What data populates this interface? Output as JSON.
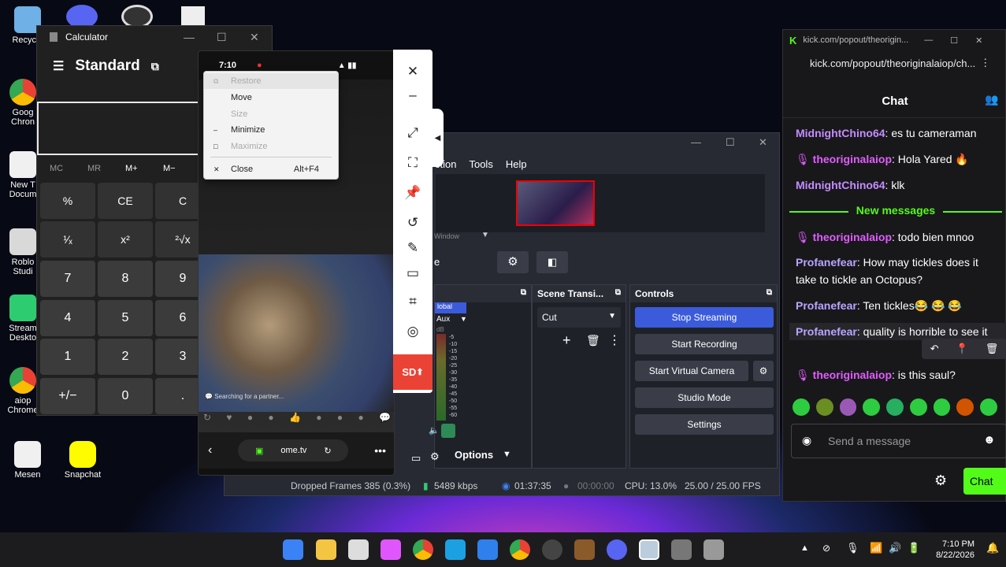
{
  "desktop": {
    "icons": [
      {
        "label": "Recycle",
        "color": "#6fb0e6"
      },
      {
        "label": "Goog\nChron",
        "color": "#e94235"
      },
      {
        "label": "New T\nDocum",
        "color": "#f0f0f0"
      },
      {
        "label": "Roblo\nStudi",
        "color": "#d9d9d9"
      },
      {
        "label": "Stream\nDeskto",
        "color": "#2ecc71"
      },
      {
        "label": "aiop\nChrome",
        "color": "#e94235"
      },
      {
        "label": "Mesen",
        "color": "#f0f0f0"
      },
      {
        "label": "Snapchat",
        "color": "#fffc00"
      }
    ]
  },
  "calculator": {
    "title": "Calculator",
    "mode": "Standard",
    "memory": [
      "MC",
      "MR",
      "M+",
      "M−"
    ],
    "keys": [
      "%",
      "CE",
      "C",
      "¹⁄ₓ",
      "x²",
      "²√x",
      "7",
      "8",
      "9",
      "4",
      "5",
      "6",
      "1",
      "2",
      "3",
      "+/−",
      "0",
      "."
    ]
  },
  "phone": {
    "time": "7:10",
    "searching": "Searching for a partner...",
    "url": "ome.tv"
  },
  "context_menu": {
    "items": [
      {
        "label": "Restore",
        "glyph": "⧉",
        "accel": "",
        "disabled": true
      },
      {
        "label": "Move",
        "glyph": "",
        "accel": "",
        "disabled": false
      },
      {
        "label": "Size",
        "glyph": "",
        "accel": "",
        "disabled": true
      },
      {
        "label": "Minimize",
        "glyph": "–",
        "accel": "",
        "disabled": false
      },
      {
        "label": "Maximize",
        "glyph": "□",
        "accel": "",
        "disabled": true
      },
      {
        "label": "Close",
        "glyph": "✕",
        "accel": "Alt+F4",
        "disabled": false
      }
    ]
  },
  "snip_toolbar": {
    "sd_label": "SD"
  },
  "obs": {
    "menu": [
      "ction",
      "Tools",
      "Help"
    ],
    "source_label": "Window",
    "scene_label": "e",
    "mixer": {
      "header": "",
      "global": "lobal",
      "aux": "Aux",
      "db": "dB",
      "levels": [
        "-5",
        "-10",
        "-15",
        "-20",
        "-25",
        "-30",
        "-35",
        "-40",
        "-45",
        "-50",
        "-55",
        "-60"
      ]
    },
    "transitions": {
      "header": "Scene Transi...",
      "value": "Cut"
    },
    "controls": {
      "header": "Controls",
      "stop_streaming": "Stop Streaming",
      "start_recording": "Start Recording",
      "start_virtual_camera": "Start Virtual Camera",
      "studio_mode": "Studio Mode",
      "settings": "Settings"
    },
    "options_label": "Options",
    "status": {
      "dropped": "Dropped Frames 385 (0.3%)",
      "kbps": "5489 kbps",
      "stream_time": "01:37:35",
      "rec_time": "00:00:00",
      "cpu": "CPU: 13.0%",
      "fps": "25.00 / 25.00 FPS"
    },
    "accent": "#3b5bdb"
  },
  "chat": {
    "tab_title": "kick.com/popout/theoriginalaiop/ch...",
    "tab_title_short": "kick.com/popout/theorigin...",
    "header": "Chat",
    "messages": [
      {
        "user": "MidnightChino64",
        "text": ": es tu cameraman",
        "color": "#c58cff"
      },
      {
        "user": "theoriginalaiop",
        "text": ": Hola Yared 🔥",
        "color": "#e25cff"
      },
      {
        "user": "MidnightChino64",
        "text": ": klk",
        "color": "#c58cff"
      },
      {
        "user": "theoriginalaiop",
        "text": ": todo bien mnoo",
        "color": "#e25cff"
      },
      {
        "user": "Profanefear",
        "text": ": How may tickles does it take to tickle an Octopus?",
        "color": "#b9a6ff"
      },
      {
        "user": "Profanefear",
        "text": ": Ten tickles😂 😂 😂",
        "color": "#b9a6ff"
      },
      {
        "user": "Profanefear",
        "text": ": quality is horrible to see it",
        "color": "#b9a6ff"
      },
      {
        "user": "theoriginalaiop",
        "text": ": is this saul?",
        "color": "#e25cff"
      }
    ],
    "new_messages": "New messages",
    "placeholder": "Send a message",
    "send_label": "Chat",
    "brand": "#53fc18"
  },
  "taskbar": {
    "time": "7:10 PM",
    "date": "8/22/2026"
  }
}
